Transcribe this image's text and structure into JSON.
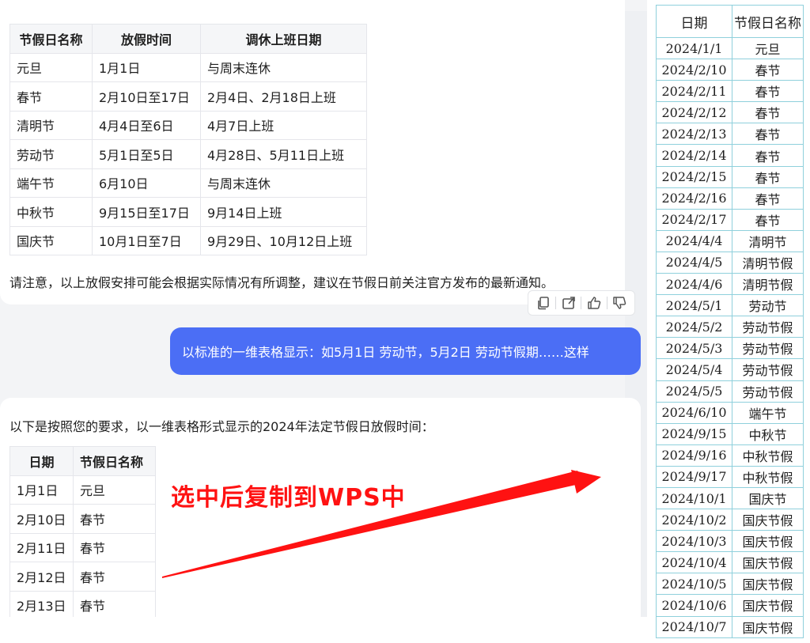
{
  "holiday_table": {
    "headers": [
      "节假日名称",
      "放假时间",
      "调休上班日期"
    ],
    "rows": [
      [
        "元旦",
        "1月1日",
        "与周末连休"
      ],
      [
        "春节",
        "2月10日至17日",
        "2月4日、2月18日上班"
      ],
      [
        "清明节",
        "4月4日至6日",
        "4月7日上班"
      ],
      [
        "劳动节",
        "5月1日至5日",
        "4月28日、5月11日上班"
      ],
      [
        "端午节",
        "6月10日",
        "与周末连休"
      ],
      [
        "中秋节",
        "9月15日至17日",
        "9月14日上班"
      ],
      [
        "国庆节",
        "10月1日至7日",
        "9月29日、10月12日上班"
      ]
    ]
  },
  "note": "请注意，以上放假安排可能会根据实际情况有所调整，建议在节假日前关注官方发布的最新通知。",
  "actions": {
    "icons": [
      "copy-icon",
      "share-icon",
      "thumbs-up-icon",
      "thumbs-down-icon"
    ]
  },
  "user_message": "以标准的一维表格显示：如5月1日 劳动节，5月2日 劳动节假期……这样",
  "intro": "以下是按照您的要求，以一维表格形式显示的2024年法定节假日放假时间：",
  "date_table": {
    "headers": [
      "日期",
      "节假日名称"
    ],
    "rows": [
      [
        "1月1日",
        "元旦"
      ],
      [
        "2月10日",
        "春节"
      ],
      [
        "2月11日",
        "春节"
      ],
      [
        "2月12日",
        "春节"
      ],
      [
        "2月13日",
        "春节"
      ]
    ]
  },
  "annotation": "选中后复制到WPS中",
  "wps_table": {
    "headers": [
      "日期",
      "节假日名称"
    ],
    "rows": [
      [
        "2024/1/1",
        "元旦"
      ],
      [
        "2024/2/10",
        "春节"
      ],
      [
        "2024/2/11",
        "春节"
      ],
      [
        "2024/2/12",
        "春节"
      ],
      [
        "2024/2/13",
        "春节"
      ],
      [
        "2024/2/14",
        "春节"
      ],
      [
        "2024/2/15",
        "春节"
      ],
      [
        "2024/2/16",
        "春节"
      ],
      [
        "2024/2/17",
        "春节"
      ],
      [
        "2024/4/4",
        "清明节"
      ],
      [
        "2024/4/5",
        "清明节假"
      ],
      [
        "2024/4/6",
        "清明节假"
      ],
      [
        "2024/5/1",
        "劳动节"
      ],
      [
        "2024/5/2",
        "劳动节假"
      ],
      [
        "2024/5/3",
        "劳动节假"
      ],
      [
        "2024/5/4",
        "劳动节假"
      ],
      [
        "2024/5/5",
        "劳动节假"
      ],
      [
        "2024/6/10",
        "端午节"
      ],
      [
        "2024/9/15",
        "中秋节"
      ],
      [
        "2024/9/16",
        "中秋节假"
      ],
      [
        "2024/9/17",
        "中秋节假"
      ],
      [
        "2024/10/1",
        "国庆节"
      ],
      [
        "2024/10/2",
        "国庆节假"
      ],
      [
        "2024/10/3",
        "国庆节假"
      ],
      [
        "2024/10/4",
        "国庆节假"
      ],
      [
        "2024/10/5",
        "国庆节假"
      ],
      [
        "2024/10/6",
        "国庆节假"
      ],
      [
        "2024/10/7",
        "国庆节假"
      ]
    ]
  },
  "colors": {
    "user_bubble": "#4b6ef5",
    "annotation": "#ff1212",
    "wps_grid": "#8fd0dc"
  }
}
